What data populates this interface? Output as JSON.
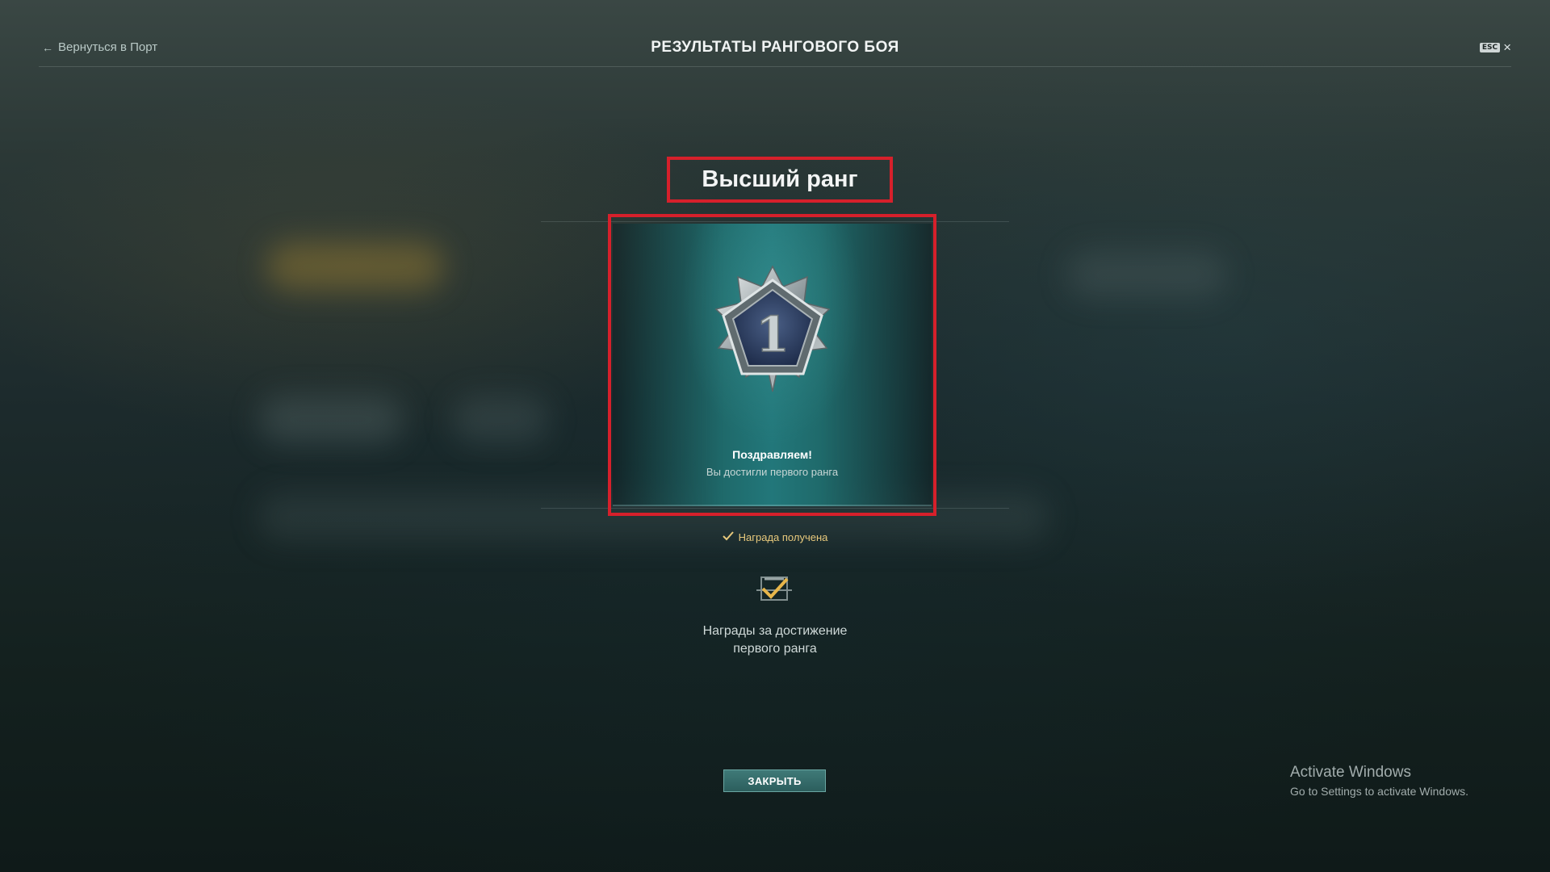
{
  "header": {
    "back_label": "Вернуться в Порт",
    "title": "РЕЗУЛЬТАТЫ РАНГОВОГО БОЯ",
    "esc_label": "ESC",
    "close_symbol": "×"
  },
  "rank": {
    "heading": "Высший ранг",
    "rank_number": "1",
    "congrats": "Поздравляем!",
    "message": "Вы достигли первого ранга"
  },
  "reward": {
    "status": "Награда получена",
    "title_line1": "Награды за достижение",
    "title_line2": "первого ранга"
  },
  "actions": {
    "close_label": "ЗАКРЫТЬ"
  },
  "watermark": {
    "line1": "Activate Windows",
    "line2": "Go to Settings to activate Windows."
  },
  "icons": {
    "back": "arrow-left-icon",
    "close": "close-icon",
    "medal": "rank-medal-icon",
    "check": "check-icon",
    "reward": "reward-received-icon"
  },
  "colors": {
    "highlight_frame": "#d6202b",
    "accent_gold": "#e8c97c",
    "card_teal": "#22777a"
  }
}
